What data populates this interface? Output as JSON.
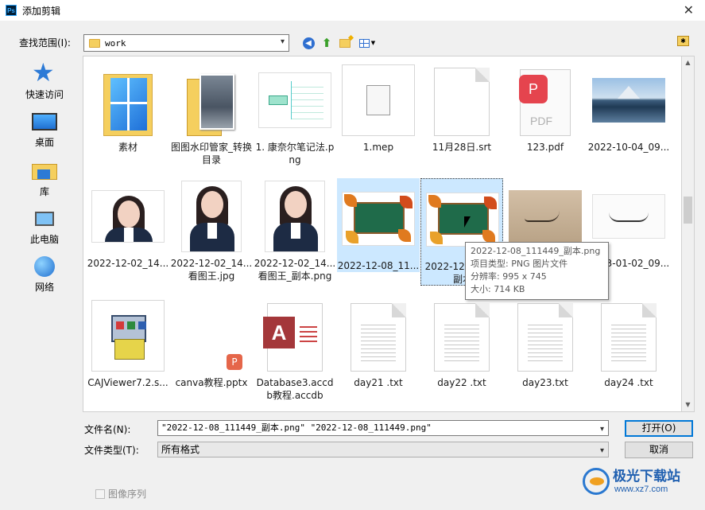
{
  "window": {
    "app_icon": "Ps",
    "title": "添加剪辑",
    "close": "✕"
  },
  "lookin": {
    "label": "查找范围(I):",
    "value": "work"
  },
  "places": [
    {
      "label": "快速访问",
      "icon": "star-icon"
    },
    {
      "label": "桌面",
      "icon": "desktop-icon"
    },
    {
      "label": "库",
      "icon": "library-icon"
    },
    {
      "label": "此电脑",
      "icon": "computer-icon"
    },
    {
      "label": "网络",
      "icon": "network-icon"
    }
  ],
  "files": [
    {
      "label": "素材",
      "kind": "win-folder"
    },
    {
      "label": "图图水印管家_转换目录",
      "kind": "photo-folder"
    },
    {
      "label": "1. 康奈尔笔记法.png",
      "kind": "mindmap"
    },
    {
      "label": "1.mep",
      "kind": "blank"
    },
    {
      "label": "11月28日.srt",
      "kind": "page"
    },
    {
      "label": "123.pdf",
      "kind": "pdf",
      "badge": "P",
      "badge_text": "PDF"
    },
    {
      "label": "2022-10-04_09...",
      "kind": "landscape"
    },
    {
      "label": "2022-12-02_14...",
      "kind": "portrait-wide"
    },
    {
      "label": "2022-12-02_14...看图王.jpg",
      "kind": "portrait"
    },
    {
      "label": "2022-12-02_14...看图王_副本.png",
      "kind": "portrait"
    },
    {
      "label": "2022-12-08_11...",
      "kind": "chalkboard",
      "state": "selected"
    },
    {
      "label": "2022-12-0...49_副本",
      "kind": "chalkboard",
      "state": "focused"
    },
    {
      "label": "",
      "kind": "signature"
    },
    {
      "label": "2023-01-02_09...",
      "kind": "signature2"
    },
    {
      "label": "CAJViewer7.2.s...",
      "kind": "installer"
    },
    {
      "label": "canva教程.pptx",
      "kind": "pptx",
      "badge": "P"
    },
    {
      "label": "Database3.accdb教程.accdb",
      "kind": "access",
      "badge": "A"
    },
    {
      "label": "day21 .txt",
      "kind": "text"
    },
    {
      "label": "day22 .txt",
      "kind": "text"
    },
    {
      "label": "day23.txt",
      "kind": "text"
    },
    {
      "label": "day24 .txt",
      "kind": "text"
    }
  ],
  "tooltip": {
    "name": "2022-12-08_111449_副本.png",
    "type": "项目类型: PNG 图片文件",
    "resolution": "分辨率: 995 x 745",
    "size": "大小: 714 KB"
  },
  "filename": {
    "label": "文件名(N):",
    "value": "\"2022-12-08_111449_副本.png\" \"2022-12-08_111449.png\""
  },
  "filetype": {
    "label": "文件类型(T):",
    "value": "所有格式"
  },
  "buttons": {
    "open": "打开(O)",
    "cancel": "取消"
  },
  "image_sequence": {
    "label": "图像序列",
    "checked": false
  },
  "watermark": {
    "title": "极光下载站",
    "url": "www.xz7.com"
  },
  "colors": {
    "selection": "#cce8ff",
    "accent": "#0078d7"
  }
}
